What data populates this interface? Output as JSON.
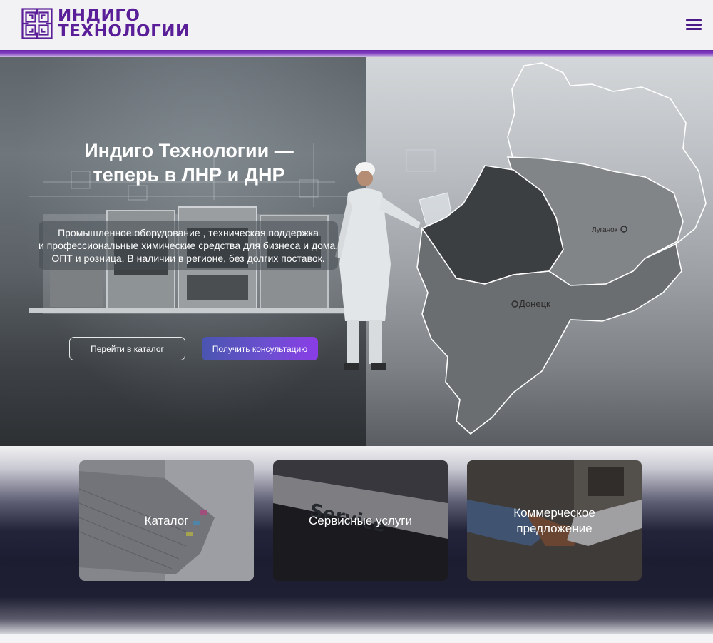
{
  "header": {
    "logo_line1": "ИНДИГО",
    "logo_line2": "ТЕХНОЛОГИИ",
    "brand_color": "#5a1f98"
  },
  "hero": {
    "title_line1": "Индиго Технологии —",
    "title_line2": "теперь в ЛНР и ДНР",
    "text_line1": "Промышленное оборудование , техническая поддержка",
    "text_line2": "и профессиональные химические средства для бизнеса и дома.",
    "text_line3": "ОПТ и розница. В наличии в регионе, без долгих поставок.",
    "map_city1": "Луганок",
    "map_city2": "Донецк",
    "btn_catalog": "Перейти в каталог",
    "btn_consult": "Получить консультацию",
    "accent_color": "#8a3de6"
  },
  "cards": [
    {
      "label": "Каталог"
    },
    {
      "label": "Сервисные услуги",
      "photo_text": "Service"
    },
    {
      "label": "Коммерческое предложение"
    }
  ]
}
